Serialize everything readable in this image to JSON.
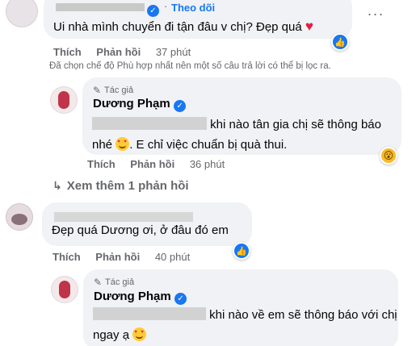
{
  "comment1": {
    "follow_label": "Theo dõi",
    "text": "Ui nhà mình chuyển đi tận đâu v chị? Đẹp quá",
    "heart_icon": "heart-icon",
    "actions": {
      "like": "Thích",
      "reply": "Phản hồi",
      "time": "37 phút"
    },
    "notice": "Đã chọn chế độ Phù hợp nhất nên một số câu trả lời có thể bị lọc ra."
  },
  "reply1": {
    "author_badge": "Tác giả",
    "author_name": "Dương Phạm",
    "text_line1": "khi nào tân gia chị sẽ thông báo",
    "text_line2_a": "nhé",
    "text_line2_b": ". E chỉ việc chuẩn bị quà thui.",
    "actions": {
      "like": "Thích",
      "reply": "Phản hồi",
      "time": "36 phút"
    }
  },
  "more_replies": {
    "label": "Xem thêm 1 phản hồi"
  },
  "comment2": {
    "text": "Đẹp quá Dương ơi, ở đâu đó em",
    "actions": {
      "like": "Thích",
      "reply": "Phản hồi",
      "time": "40 phút"
    }
  },
  "reply2": {
    "author_badge": "Tác giả",
    "author_name": "Dương Phạm",
    "text_line1": "khi nào về em sẽ thông báo với chị",
    "text_line2": "ngay ạ"
  },
  "colors": {
    "like_blue": "#1877f2",
    "heart_red": "#e41e3f",
    "wow_yellow": "#f7b928",
    "bubble_bg": "#f0f2f5",
    "meta_gray": "#65676b"
  },
  "icons": {
    "more": "more-icon",
    "verified": "verified-icon",
    "pencil": "pencil-icon",
    "reply_arrow": "reply-arrow-icon"
  }
}
